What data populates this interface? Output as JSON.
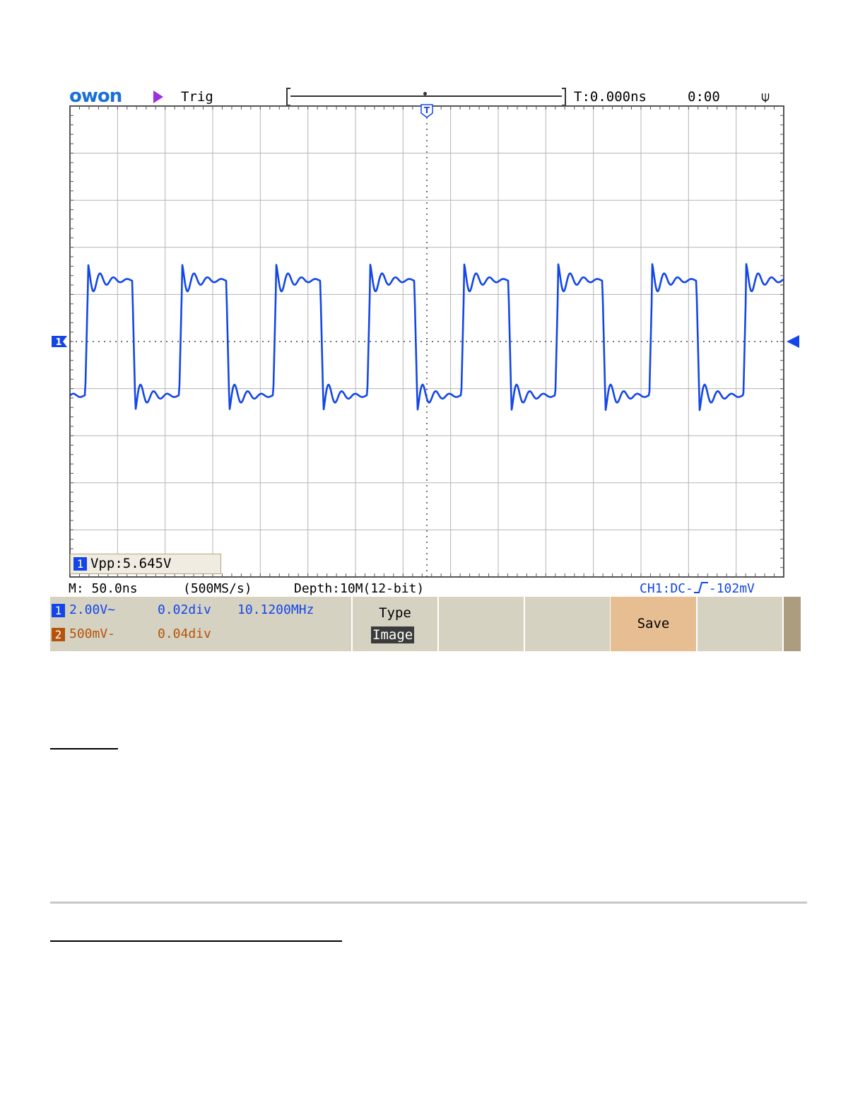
{
  "scope": {
    "brand": "owon",
    "run_state_icon": "play-triangle-icon",
    "trigger_status": "Trig",
    "trigger_time": "T:0.000ns",
    "clock": "0:00",
    "usb_icon": "usb-icon",
    "measurement": {
      "channel": "1",
      "text": "Vpp:5.645V"
    },
    "status": {
      "timebase": "M: 50.0ns",
      "sample_rate": "(500MS/s)",
      "depth": "Depth:10M(12-bit)",
      "trigger_info": "CH1:DC-↗-102mV",
      "trigger_prefix": "CH1:DC-",
      "trigger_suffix": "-102mV"
    },
    "channels": [
      {
        "id": "1",
        "scale": "2.00V~",
        "offset": "0.02div",
        "frequency": "10.1200MHz"
      },
      {
        "id": "2",
        "scale": "500mV-",
        "offset": "0.04div"
      }
    ],
    "menu": {
      "type_label": "Type",
      "type_value": "Image",
      "save_label": "Save"
    },
    "colors": {
      "waveform": "#1346e8",
      "grid": "#b5b5b5",
      "save_button": "#e7bd92",
      "menu_bg": "#d6d2c2",
      "ch2": "#b45309"
    }
  },
  "chart_data": {
    "type": "line",
    "title": "",
    "xlabel": "",
    "ylabel": "",
    "x_divisions": 15,
    "y_divisions": 10,
    "time_per_div_ns": 50,
    "volts_per_div": 2.0,
    "xlim_ns": [
      -375,
      375
    ],
    "ylim_div": [
      -5,
      5
    ],
    "grid": true,
    "series": [
      {
        "waveform": "square",
        "frequency_mhz": 10.12,
        "period_ns": 98.8,
        "vpp_v": 5.645,
        "high_div": 1.3,
        "low_div": -1.15,
        "ringing": true
      }
    ]
  }
}
